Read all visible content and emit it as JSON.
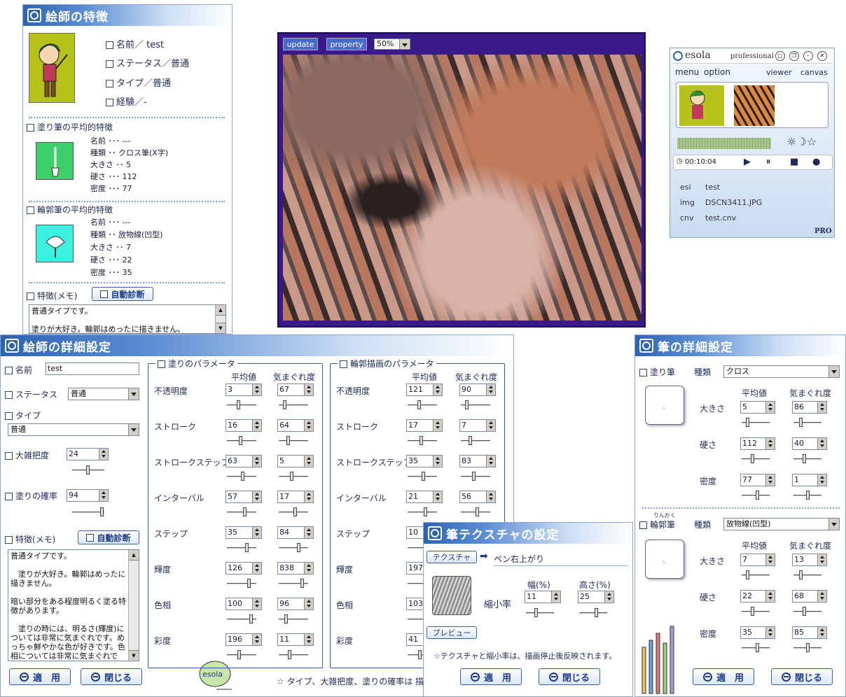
{
  "profile": {
    "title": "絵師の特徴",
    "name": "名前／ test",
    "status": "ステータス／普通",
    "type": "タイプ／普通",
    "exp": "経験／-",
    "paint_brush": {
      "header": "塗り筆の平均的特徴",
      "rows": [
        "名前 ･･･ ---",
        "種類 ･･ クロス筆(X字)",
        "大きさ ･･ 5",
        "硬さ ･･･ 112",
        "密度 ･･･ 77"
      ]
    },
    "outline_brush": {
      "header": "輪郭筆の平均的特徴",
      "rows": [
        "名前 ･･･ ---",
        "種類 ･･ 放物線(凹型)",
        "大きさ ･･ 7",
        "硬さ ･･･ 22",
        "密度 ･･･ 35"
      ]
    },
    "memo_label": "特徴(メモ)",
    "auto_diag": "自動診断",
    "memo_text": "普通タイプです。\n\n塗りが大好き。輪郭はめったに描きません。"
  },
  "viewer": {
    "update": "update",
    "property": "property",
    "zoom": "50%"
  },
  "player": {
    "logo": "esola",
    "edition": "professional",
    "menu": "menu",
    "option": "option",
    "viewer": "viewer",
    "canvas": "canvas",
    "time": "00:10:04",
    "esi_k": "esi",
    "esi_v": "test",
    "img_k": "img",
    "img_v": "DSCN3411.JPG",
    "cnv_k": "cnv",
    "cnv_v": "test.cnv",
    "pro": "PRO"
  },
  "detail": {
    "title": "絵師の詳細設定",
    "name_label": "名前",
    "name_value": "test",
    "status_label": "ステータス",
    "status_value": "普通",
    "type_label": "タイプ",
    "type_value": "普通",
    "rough_label": "大雑把度",
    "rough_value": "24",
    "paint_rate_label": "塗りの確率",
    "paint_rate_value": "94",
    "memo_label": "特徴(メモ)",
    "auto_diag": "自動診断",
    "memo_text": "普通タイプです。\n\n　塗りが大好き。輪郭はめったに描きません。\n\n暗い部分をある程度明るく塗る特徴があります。\n\n　塗りの時には、明るさ(輝度)については非常に気まぐれです。めっちゃ鮮やかな色が好きです。色相については非常に気まぐれです。とても透明度が高いで",
    "apply": "適　用",
    "close": "閉じる",
    "note": "☆ タイプ、大雑把度、塗りの確率は 描画",
    "paint_params": {
      "title": "塗りのパラメータ",
      "avg": "平均値",
      "whim": "気まぐれ度",
      "rows": [
        {
          "label": "不透明度",
          "a": "3",
          "b": "67"
        },
        {
          "label": "ストローク",
          "a": "16",
          "b": "64"
        },
        {
          "label": "ストロークステップ",
          "a": "63",
          "b": "5"
        },
        {
          "label": "インターバル",
          "a": "57",
          "b": "17"
        },
        {
          "label": "ステップ",
          "a": "35",
          "b": "84"
        },
        {
          "label": "輝度",
          "a": "126",
          "b": "838"
        },
        {
          "label": "色相",
          "a": "100",
          "b": "96"
        },
        {
          "label": "彩度",
          "a": "196",
          "b": "11"
        }
      ]
    },
    "outline_params": {
      "title": "輪郭描画のパラメータ",
      "avg": "平均値",
      "whim": "気まぐれ度",
      "rows": [
        {
          "label": "不透明度",
          "a": "121",
          "b": "90"
        },
        {
          "label": "ストローク",
          "a": "17",
          "b": "7"
        },
        {
          "label": "ストロークステップ",
          "a": "35",
          "b": "83"
        },
        {
          "label": "インターバル",
          "a": "21",
          "b": "56"
        },
        {
          "label": "ステップ",
          "a": "10",
          "b": ""
        },
        {
          "label": "輝度",
          "a": "197",
          "b": ""
        },
        {
          "label": "色相",
          "a": "103",
          "b": ""
        },
        {
          "label": "彩度",
          "a": "41",
          "b": ""
        }
      ]
    }
  },
  "texture": {
    "title": "筆テクスチャの設定",
    "tab": "テクスチャ",
    "name": "ペン右上がり",
    "scale_label": "縮小率",
    "width_label": "幅(%)",
    "height_label": "高さ(%)",
    "width": "11",
    "height": "25",
    "preview": "プレビュー",
    "note": "☆テクスチャと縮小率は、描画停止後反映されます。",
    "apply": "適　用",
    "close": "閉じる"
  },
  "brush": {
    "title": "筆の詳細設定",
    "paint": "塗り筆",
    "kind": "種類",
    "paint_kind": "クロス",
    "avg": "平均値",
    "whim": "気まぐれ度",
    "paint_rows": [
      {
        "label": "大きさ",
        "a": "5",
        "b": "86"
      },
      {
        "label": "硬さ",
        "a": "112",
        "b": "40"
      },
      {
        "label": "密度",
        "a": "77",
        "b": "1"
      }
    ],
    "ruby": "りんかく",
    "outline": "輪郭筆",
    "outline_kind": "放物線(凹型)",
    "outline_rows": [
      {
        "label": "大きさ",
        "a": "7",
        "b": "13"
      },
      {
        "label": "硬さ",
        "a": "22",
        "b": "68"
      },
      {
        "label": "密度",
        "a": "35",
        "b": "85"
      }
    ],
    "apply": "適　用",
    "close": "閉じる"
  },
  "colors": {
    "accent": "#2d63b5",
    "frame": "#3a1a8a"
  }
}
